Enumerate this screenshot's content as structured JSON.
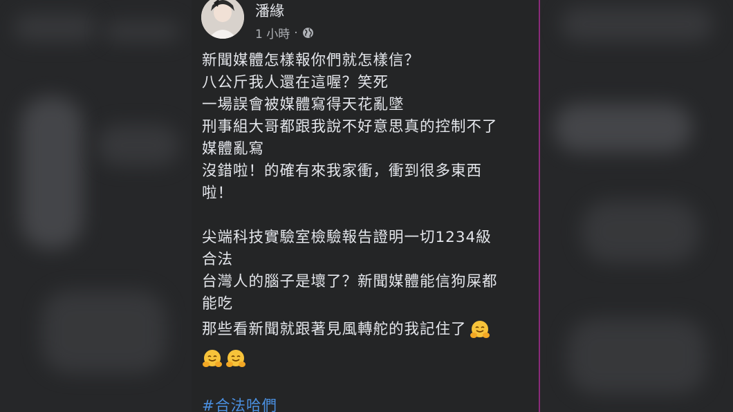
{
  "post": {
    "author": "潘緣",
    "timestamp": "1 小時",
    "separator": "·",
    "privacy_icon": "globe-icon",
    "paragraph1": [
      "新聞媒體怎樣報你們就怎樣信？",
      "八公斤我人還在這喔？笑死",
      "一場誤會被媒體寫得天花亂墜",
      "刑事組大哥都跟我說不好意思真的控制不了",
      "媒體亂寫",
      "沒錯啦！的確有來我家衝，衝到很多東西",
      "啦！"
    ],
    "paragraph2": [
      "尖端科技實驗室檢驗報告證明一切1234級",
      "合法",
      "台灣人的腦子是壞了？新聞媒體能信狗屎都",
      "能吃"
    ],
    "closing_line": "那些看新聞就跟著見風轉舵的我記住了",
    "emoji": "hugging-face-icon",
    "hashtag": "#合法哈們"
  },
  "colors": {
    "card_bg": "#242526",
    "text": "#e4e6eb",
    "meta": "#b0b3b8",
    "link": "#4a8fe0",
    "edge": "#8a2b7a"
  }
}
